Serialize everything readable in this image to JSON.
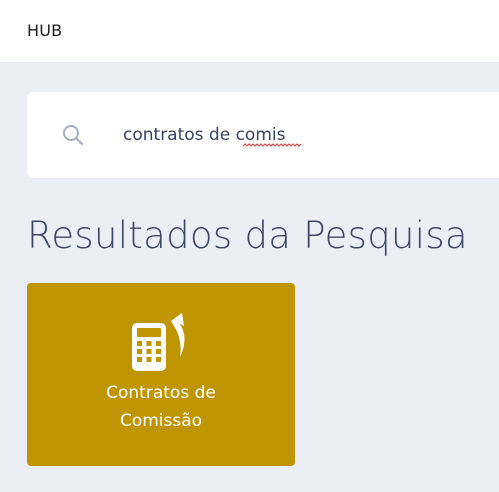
{
  "header": {
    "title": "HUB"
  },
  "search": {
    "value": "contratos de comis",
    "misspelled_word": "comis"
  },
  "results": {
    "title": "Resultados da Pesquisa",
    "items": [
      {
        "label_line1": "Contratos de",
        "label_line2": "Comissão",
        "icon": "calculator-return-icon",
        "color": "#C09503"
      }
    ]
  },
  "colors": {
    "background": "#ECEEF6",
    "card": "#C09503",
    "title_text": "#3F4660"
  }
}
